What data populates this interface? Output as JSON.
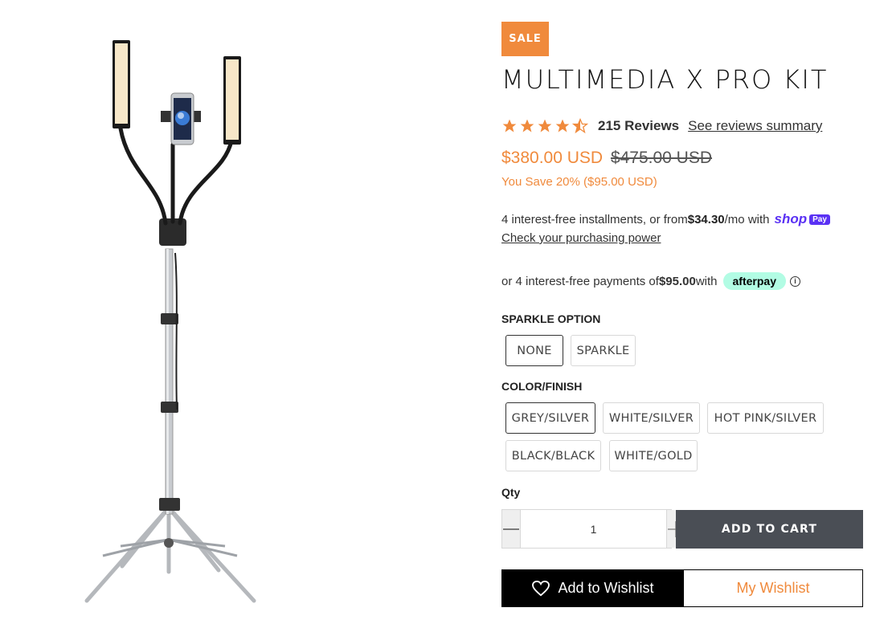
{
  "product": {
    "sale_badge": "SALE",
    "title": "MULTIMEDIA X PRO KIT",
    "image_alt": "Multimedia X Pro Kit dual LED light stand with phone holder",
    "rating": 4.5,
    "reviews_count": "215 Reviews",
    "reviews_link": "See reviews summary",
    "price_current": "$380.00 USD",
    "price_compare": "$475.00 USD",
    "savings": "You Save 20% ($95.00 USD)"
  },
  "shop_pay": {
    "text_before": "4 interest-free installments, or from ",
    "amount": "$34.30",
    "text_after": "/mo with ",
    "logo": "shop",
    "pay": "Pay",
    "check_link": "Check your purchasing power"
  },
  "afterpay": {
    "text_before": "or 4 interest-free payments of ",
    "amount": "$95.00",
    "text_after": " with",
    "logo": "afterpay",
    "info_icon": "i"
  },
  "options": {
    "sparkle_label": "SPARKLE OPTION",
    "sparkle": [
      "NONE",
      "SPARKLE"
    ],
    "color_label": "COLOR/FINISH",
    "color": [
      "GREY/SILVER",
      "WHITE/SILVER",
      "HOT PINK/SILVER",
      "BLACK/BLACK",
      "WHITE/GOLD"
    ]
  },
  "quantity": {
    "label": "Qty",
    "value": "1"
  },
  "actions": {
    "add_to_cart": "ADD TO CART",
    "add_to_wishlist": "Add to Wishlist",
    "my_wishlist": "My Wishlist"
  },
  "colors": {
    "accent": "#f08a3c",
    "cart_button": "#4a4e55",
    "shop_pay": "#5a31f4",
    "afterpay": "#b2fce4"
  }
}
